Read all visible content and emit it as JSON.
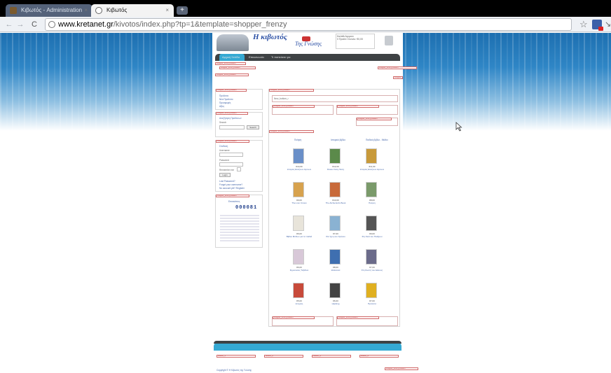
{
  "browser": {
    "tabs": [
      {
        "label": "Κιβωτός - Administration",
        "active": false
      },
      {
        "label": "Κιβωτός",
        "active": true
      }
    ],
    "new_tab_label": "+",
    "url_host": "www.kretanet.gr",
    "url_path": "/kivotos/index.php?tp=1&template=shopper_frenzy"
  },
  "site": {
    "logo_title": "Η κιβωτός",
    "logo_subtitle": "Της Γνώσης",
    "menu": [
      "Αρχική Σελίδα",
      "Επικοινωνία",
      "Τι πιστεύετε για"
    ],
    "cart_text": "Καλάθι Αγορών",
    "cart_sub": "0 Προϊόν  Σύνολο: €0,00",
    "module_tag": "shopper_frenzy position",
    "search_title": "Αναζήτηση Προϊόντων",
    "search_label": "Search",
    "search_button": "Search",
    "login_title": "Σύνδεση",
    "username_label": "Username",
    "password_label": "Password",
    "remember_label": "Remember me",
    "login_button": "Login",
    "lost_password": "Lost Password?",
    "forgot_username": "Forgot your username?",
    "register": "No account yet? Register",
    "visitors_title": "Επισκέπτες",
    "visitor_counter": "000081",
    "left_links": [
      "Προϊόντα",
      "Νέα Προϊόντα",
      "Προσφορές",
      "Αξίες"
    ],
    "featured_title": "New_bottom_r",
    "categories_header": [
      "Ποίηση",
      "Ιστορικό βιβλίο",
      "Παιδικό βιβλίο - Μύθοι"
    ],
    "products": [
      {
        "price": "€10,00",
        "name": "Ιστορίες Ελλήνων Ηρώων"
      },
      {
        "price": "€12,00",
        "name": "Flower Fairy Story"
      },
      {
        "price": "€11,00",
        "name": "Ιστορίες Ελλήνων Ηρώων"
      },
      {
        "price": "€9,00",
        "name": "The Lion Crown"
      },
      {
        "price": "€10,00",
        "name": "The Alchemist's Book"
      },
      {
        "price": "€8,00",
        "name": "Ποίηση"
      },
      {
        "price": "€6,00",
        "name": "Βιβλίο Μύθων για τα παιδιά"
      },
      {
        "price": "€7,00",
        "name": "Στα Ίχνη του Χρόνου"
      },
      {
        "price": "€9,00",
        "name": "Στη Σκιά του Πολέμου"
      },
      {
        "price": "€6,00",
        "name": "Σημειώσεις Ταξιδιού"
      },
      {
        "price": "€8,00",
        "name": "Θάλασσα"
      },
      {
        "price": "€7,00",
        "name": "Στη Σιωπή του Δάσους"
      },
      {
        "price": "€5,00",
        "name": "Ιστορίες"
      },
      {
        "price": "€6,00",
        "name": "Hacking"
      },
      {
        "price": "€7,00",
        "name": "Πρότυπα"
      }
    ],
    "footer_modules": [
      "bottom_1",
      "bottom_2",
      "bottom_3",
      "bottom_4"
    ],
    "footer_text": "Copyright © Η Κιβωτός της Γνώσης"
  },
  "colors": {
    "accent": "#35a9d3",
    "menu_dark": "#3e4244",
    "background_blue": "#2f86c6",
    "logo_blue": "#2a4fa4"
  }
}
